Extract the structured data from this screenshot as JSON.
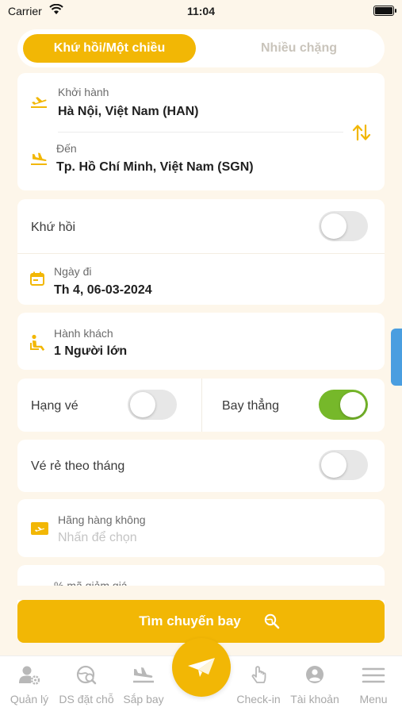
{
  "status_bar": {
    "carrier": "Carrier",
    "time": "11:04"
  },
  "trip_type": {
    "round_trip_label": "Khứ hồi/Một chiều",
    "multi_city_label": "Nhiều chặng",
    "selected": "round_trip"
  },
  "route": {
    "departure_label": "Khởi hành",
    "departure_value": "Hà Nội, Việt Nam (HAN)",
    "arrival_label": "Đến",
    "arrival_value": "Tp. Hồ Chí Minh, Việt Nam (SGN)"
  },
  "round_trip": {
    "label": "Khứ hồi",
    "enabled": false
  },
  "date": {
    "label": "Ngày đi",
    "value": "Th 4, 06-03-2024"
  },
  "passengers": {
    "label": "Hành khách",
    "value": "1 Người lớn"
  },
  "ticket_class": {
    "label": "Hạng vé",
    "enabled": false
  },
  "direct_flight": {
    "label": "Bay thẳng",
    "enabled": true
  },
  "monthly_cheap": {
    "label": "Vé rẻ theo tháng",
    "enabled": false
  },
  "airline": {
    "label": "Hãng hàng không",
    "placeholder": "Nhấn để chọn"
  },
  "promo": {
    "label": "% mã giảm giá"
  },
  "search_button": {
    "label": "Tìm chuyến bay"
  },
  "colors": {
    "accent": "#f2b705",
    "toggle_on": "#76b82a",
    "background": "#fdf6ea"
  },
  "tab_bar": {
    "items": [
      {
        "label": "Quản lý",
        "icon": "user-gear-icon"
      },
      {
        "label": "DS đặt chỗ",
        "icon": "globe-search-icon"
      },
      {
        "label": "Sắp bay",
        "icon": "plane-landing-icon"
      },
      {
        "label": "Check-in",
        "icon": "tap-hand-icon"
      },
      {
        "label": "Tài khoản",
        "icon": "account-icon"
      },
      {
        "label": "Menu",
        "icon": "menu-icon"
      }
    ],
    "center_icon": "paper-plane-icon"
  }
}
